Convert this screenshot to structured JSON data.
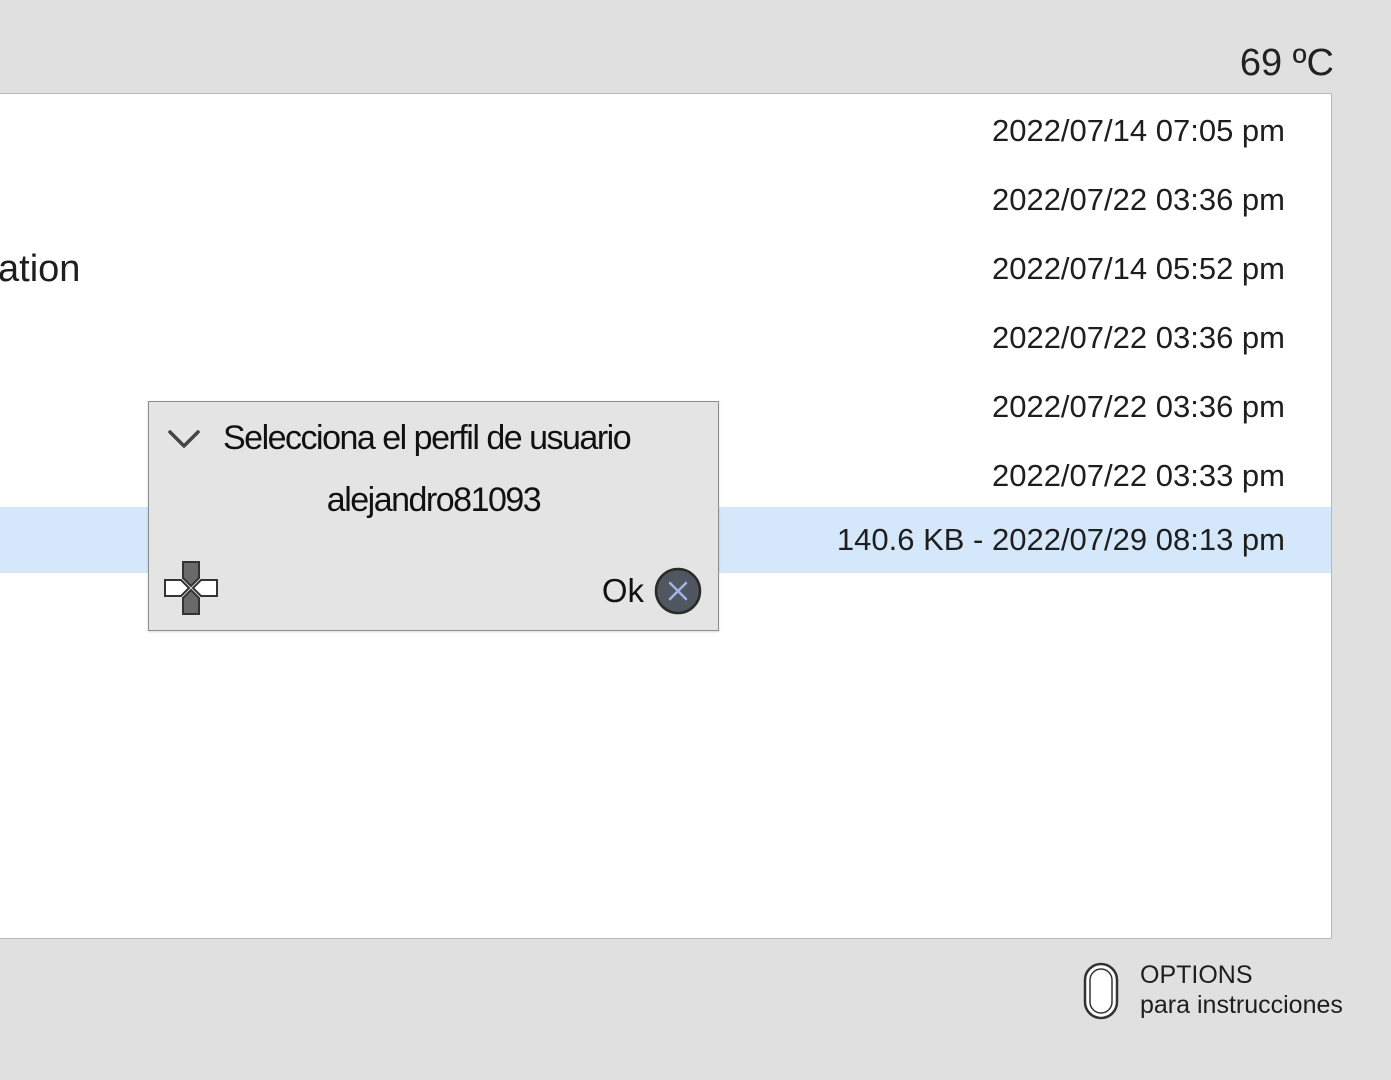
{
  "status": {
    "temperature": "69 ºC"
  },
  "list": {
    "rows": [
      {
        "title": "",
        "info": "2022/07/14 07:05 pm"
      },
      {
        "title": "",
        "info": "2022/07/22 03:36 pm"
      },
      {
        "title": "ation",
        "info": "2022/07/14 05:52 pm"
      },
      {
        "title": "",
        "info": "2022/07/22 03:36 pm"
      },
      {
        "title": "",
        "info": "2022/07/22 03:36 pm"
      },
      {
        "title": "",
        "info": "2022/07/22 03:33 pm"
      },
      {
        "title": "",
        "info": "140.6 KB - 2022/07/29 08:13 pm",
        "selected": true
      }
    ]
  },
  "dialog": {
    "heading": "Selecciona el perfil de usuario",
    "profile_name": "alejandro81093",
    "ok_label": "Ok",
    "icons": {
      "expand": "chevron-down-icon",
      "dpad": "dpad-icon",
      "confirm": "cross-button-icon"
    }
  },
  "footer": {
    "options_label": "OPTIONS",
    "options_hint": "para instrucciones",
    "icon": "touchpad-button-icon"
  },
  "colors": {
    "background": "#e0e0e0",
    "panel": "#ffffff",
    "selection": "#d5e7fb",
    "dialog": "#e4e4e4"
  }
}
